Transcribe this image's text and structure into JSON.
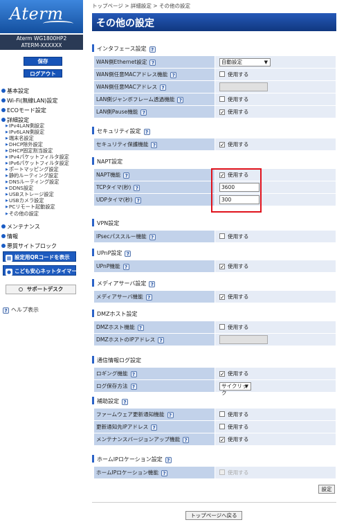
{
  "sidebar": {
    "logo": "Aterm",
    "model_line1": "Aterm WG1800HP2",
    "model_line2": "ATERM-XXXXXX",
    "save_label": "保存",
    "logout_label": "ログアウト",
    "nav": [
      {
        "label": "基本設定",
        "level": "main"
      },
      {
        "label": "Wi-Fi(無線LAN)設定",
        "level": "main"
      },
      {
        "label": "ECOモード設定",
        "level": "main"
      },
      {
        "label": "詳細設定",
        "level": "main"
      },
      {
        "label": "IPv4LAN側設定",
        "level": "sub"
      },
      {
        "label": "IPv6LAN側設定",
        "level": "sub"
      },
      {
        "label": "端末名設定",
        "level": "sub"
      },
      {
        "label": "DHCP除外設定",
        "level": "sub"
      },
      {
        "label": "DHCP固定割当設定",
        "level": "sub"
      },
      {
        "label": "IPv4パケットフィルタ設定",
        "level": "sub"
      },
      {
        "label": "IPv6パケットフィルタ設定",
        "level": "sub"
      },
      {
        "label": "ポートマッピング設定",
        "level": "sub"
      },
      {
        "label": "静的ルーティング設定",
        "level": "sub"
      },
      {
        "label": "DNSルーティング設定",
        "level": "sub"
      },
      {
        "label": "DDNS設定",
        "level": "sub"
      },
      {
        "label": "USBストレージ設定",
        "level": "sub"
      },
      {
        "label": "USBカメラ設定",
        "level": "sub"
      },
      {
        "label": "PCリモート起動設定",
        "level": "sub"
      },
      {
        "label": "その他の設定",
        "level": "sub"
      },
      {
        "label": "メンテナンス",
        "level": "main"
      },
      {
        "label": "情報",
        "level": "main"
      },
      {
        "label": "悪質サイトブロック",
        "level": "main"
      }
    ],
    "qr_button": "設定用QRコードを表示",
    "child_button": "こども安心ネットタイマー",
    "support_button": "サポートデスク",
    "help_label": "ヘルプ表示"
  },
  "breadcrumb": "トップページ > 詳細設定 > その他の設定",
  "page_title": "その他の設定",
  "sections": [
    {
      "title": "インタフェース設定",
      "rows": [
        {
          "label": "WAN側Ethernet設定",
          "type": "select",
          "value": "自動設定"
        },
        {
          "label": "WAN側任意MACアドレス機能",
          "type": "checkbox",
          "checked": false,
          "text": "使用する"
        },
        {
          "label": "WAN側任意MACアドレス",
          "type": "text",
          "disabled": true,
          "value": ""
        },
        {
          "label": "LAN側ジャンボフレーム透過機能",
          "type": "checkbox",
          "checked": false,
          "text": "使用する"
        },
        {
          "label": "LAN側Pause機能",
          "type": "checkbox",
          "checked": true,
          "text": "使用する"
        }
      ]
    },
    {
      "title": "セキュリティ設定",
      "rows": [
        {
          "label": "セキュリティ保護機能",
          "type": "checkbox",
          "checked": true,
          "text": "使用する"
        }
      ]
    },
    {
      "title": "NAPT設定",
      "rows": [
        {
          "label": "NAPT機能",
          "type": "checkbox",
          "checked": true,
          "text": "使用する"
        },
        {
          "label": "TCPタイマ(秒)",
          "type": "text",
          "disabled": false,
          "value": "3600"
        },
        {
          "label": "UDPタイマ(秒)",
          "type": "text",
          "disabled": false,
          "value": "300"
        }
      ]
    },
    {
      "title": "VPN設定",
      "rows": [
        {
          "label": "IPsecパススルー機能",
          "type": "checkbox",
          "checked": false,
          "text": "使用する"
        }
      ]
    },
    {
      "title": "UPnP設定",
      "rows": [
        {
          "label": "UPnP機能",
          "type": "checkbox",
          "checked": true,
          "text": "使用する"
        }
      ]
    },
    {
      "title": "メディアサーバ設定",
      "rows": [
        {
          "label": "メディアサーバ機能",
          "type": "checkbox",
          "checked": true,
          "text": "使用する"
        }
      ]
    },
    {
      "title": "DMZホスト設定",
      "rows": [
        {
          "label": "DMZホスト機能",
          "type": "checkbox",
          "checked": false,
          "text": "使用する"
        },
        {
          "label": "DMZホストのIPアドレス",
          "type": "text",
          "disabled": true,
          "value": ""
        }
      ]
    },
    {
      "title": "通信情報ログ設定",
      "rows": [
        {
          "label": "ロギング機能",
          "type": "checkbox",
          "checked": true,
          "text": "使用する"
        },
        {
          "label": "ログ保存方法",
          "type": "select",
          "value": "サイクリック"
        }
      ]
    },
    {
      "title": "補助設定",
      "rows": [
        {
          "label": "ファームウェア更新通知機能",
          "type": "checkbox",
          "checked": false,
          "text": "使用する"
        },
        {
          "label": "更新通知先IPアドレス",
          "type": "checkbox",
          "checked": false,
          "text": "使用する"
        },
        {
          "label": "メンテナンスバージョンアップ機能",
          "type": "checkbox",
          "checked": true,
          "text": "使用する"
        }
      ]
    },
    {
      "title": "ホームIPロケーション設定",
      "rows": [
        {
          "label": "ホームIPロケーション機能",
          "type": "checkbox",
          "checked": false,
          "disabled": true,
          "text": "使用する"
        }
      ]
    }
  ],
  "apply_button": "設定",
  "back_button": "トップページへ戻る",
  "colors": {
    "accent": "#153f96",
    "label_bg": "#c2d2ea",
    "value_bg": "#e6ecf6",
    "highlight": "#e0111b"
  }
}
